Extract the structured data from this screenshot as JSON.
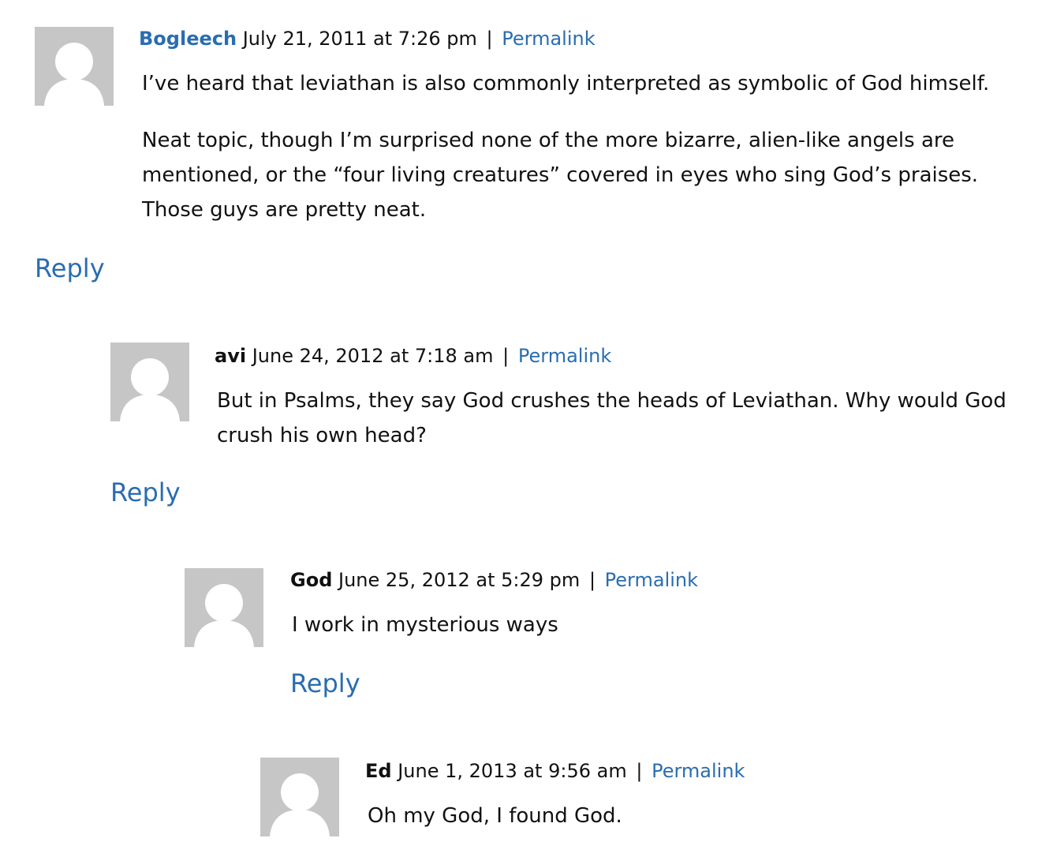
{
  "colors": {
    "link": "#2a6db0",
    "text": "#111111",
    "avatar_bg": "#c6c6c6"
  },
  "comments": [
    {
      "author": "Bogleech",
      "date": "July 21, 2011 at 7:26 pm",
      "separator": "|",
      "permalink": "Permalink",
      "paragraphs": [
        "I’ve heard that leviathan is also commonly interpreted as symbolic of God himself.",
        "Neat topic, though I’m surprised none of the more bizarre, alien-like angels are mentioned, or the “four living creatures” covered in eyes who sing God’s praises. Those guys are pretty neat."
      ],
      "reply": "Reply",
      "avatar_icon": "default-user-avatar-icon"
    },
    {
      "author": "avi",
      "date": "June 24, 2012 at 7:18 am",
      "separator": "|",
      "permalink": "Permalink",
      "paragraphs": [
        "But in Psalms, they say God crushes the heads of Leviathan. Why would God crush his own head?"
      ],
      "reply": "Reply",
      "avatar_icon": "default-user-avatar-icon"
    },
    {
      "author": "God",
      "date": "June 25, 2012 at 5:29 pm",
      "separator": "|",
      "permalink": "Permalink",
      "paragraphs": [
        "I work in mysterious ways"
      ],
      "reply": "Reply",
      "avatar_icon": "default-user-avatar-icon"
    },
    {
      "author": "Ed",
      "date": "June 1, 2013 at 9:56 am",
      "separator": "|",
      "permalink": "Permalink",
      "paragraphs": [
        "Oh my God, I found God."
      ],
      "avatar_icon": "default-user-avatar-icon"
    }
  ]
}
